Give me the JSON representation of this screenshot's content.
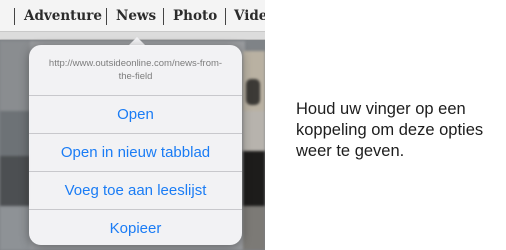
{
  "navbar": {
    "tabs": [
      {
        "label": "Adventure"
      },
      {
        "label": "News"
      },
      {
        "label": "Photo"
      },
      {
        "label": "Vide"
      }
    ]
  },
  "popover": {
    "url": "http://www.outsideonline.com/news-from-the-field",
    "actions": [
      {
        "label": "Open"
      },
      {
        "label": "Open in nieuw tabblad"
      },
      {
        "label": "Voeg toe aan leeslijst"
      },
      {
        "label": "Kopieer"
      }
    ]
  },
  "caption": "Houd uw vinger op een koppeling om deze opties weer te geven.",
  "colors": {
    "action_text": "#1a7cf5",
    "url_text": "#7d7d7d",
    "caption_text": "#1d1d1d"
  }
}
